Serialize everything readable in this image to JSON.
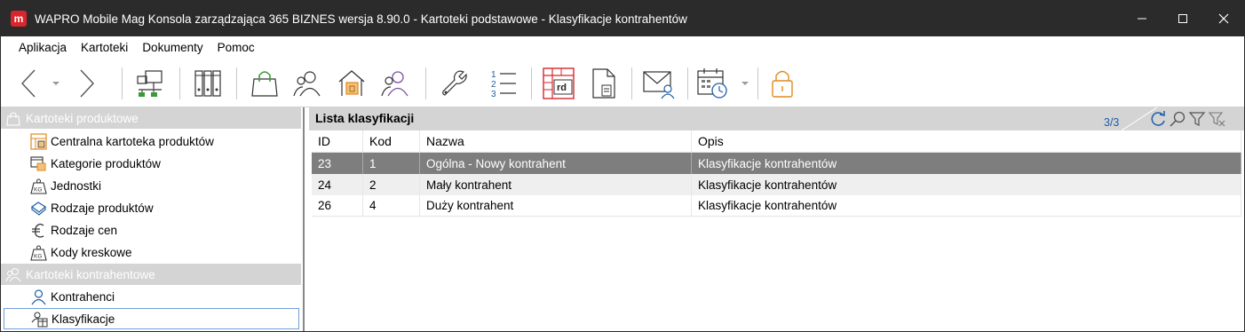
{
  "window": {
    "logo_letter": "m",
    "title": "WAPRO Mobile Mag Konsola zarządzająca 365 BIZNES wersja 8.90.0 - Kartoteki podstawowe - Klasyfikacje kontrahentów"
  },
  "menu": [
    "Aplikacja",
    "Kartoteki",
    "Dokumenty",
    "Pomoc"
  ],
  "toolbar": {
    "rd_label": "rd"
  },
  "tree": {
    "groups": [
      {
        "label": "Kartoteki produktowe",
        "icon": "shopping-bag-icon",
        "items": [
          {
            "label": "Centralna kartoteka produktów",
            "icon": "product-catalog-icon"
          },
          {
            "label": "Kategorie produktów",
            "icon": "product-categories-icon"
          },
          {
            "label": "Jednostki",
            "icon": "weight-kg-icon"
          },
          {
            "label": "Rodzaje produktów",
            "icon": "product-types-icon"
          },
          {
            "label": "Rodzaje cen",
            "icon": "euro-icon"
          },
          {
            "label": "Kody kreskowe",
            "icon": "barcode-kg-icon"
          }
        ]
      },
      {
        "label": "Kartoteki kontrahentowe",
        "icon": "contractors-icon",
        "items": [
          {
            "label": "Kontrahenci",
            "icon": "person-icon"
          },
          {
            "label": "Klasyfikacje",
            "icon": "classification-icon",
            "selected": true
          }
        ]
      }
    ]
  },
  "list": {
    "title": "Lista klasyfikacji",
    "count": "3/3",
    "columns": [
      "ID",
      "Kod",
      "Nazwa",
      "Opis"
    ],
    "rows": [
      {
        "id": "23",
        "kod": "1",
        "nazwa": "Ogólna - Nowy kontrahent",
        "opis": "Klasyfikacje kontrahentów",
        "selected": true
      },
      {
        "id": "24",
        "kod": "2",
        "nazwa": "Mały kontrahent",
        "opis": "Klasyfikacje kontrahentów"
      },
      {
        "id": "26",
        "kod": "4",
        "nazwa": "Duży kontrahent",
        "opis": "Klasyfikacje kontrahentów"
      }
    ]
  },
  "colors": {
    "titlebar": "#2b2b2b",
    "logo": "#d9262d",
    "panel_header": "#d4d4d4",
    "selected_row": "#7e7e7e",
    "accent_blue": "#1f5ea8",
    "icon_orange": "#e08a1e",
    "icon_purple": "#7b4fa0",
    "icon_red": "#d9262d"
  }
}
